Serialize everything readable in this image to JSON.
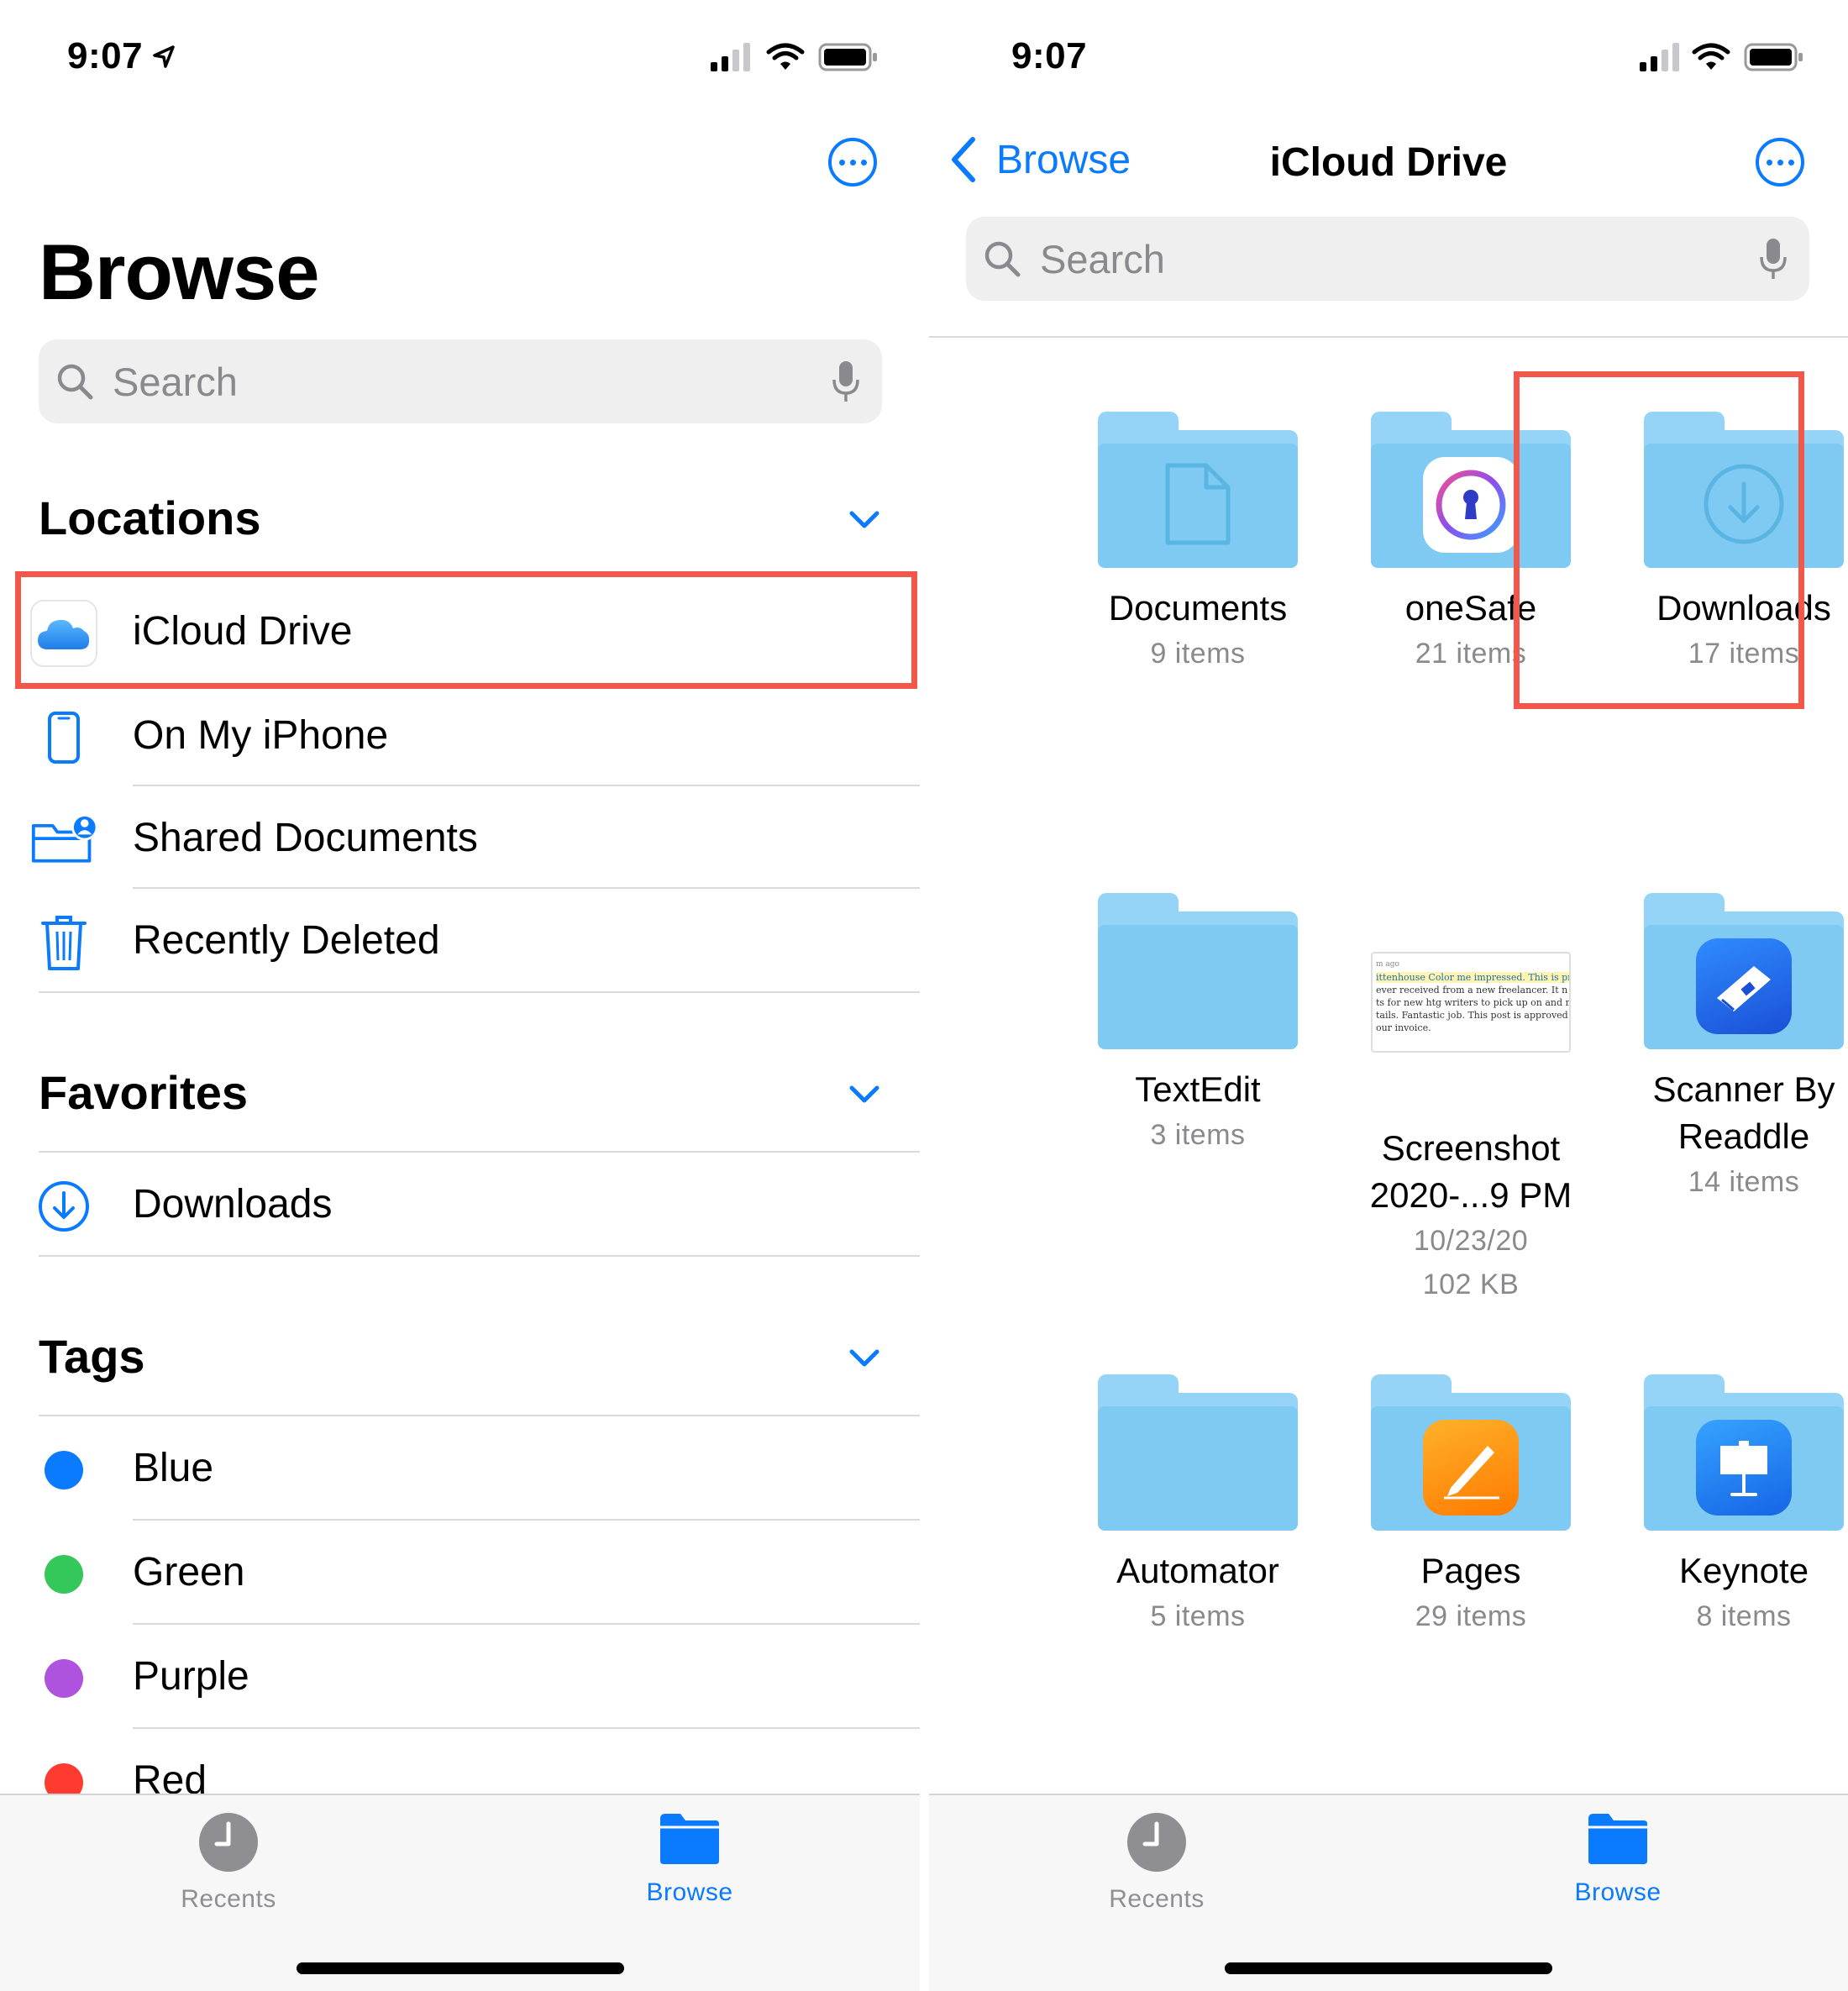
{
  "left": {
    "status": {
      "time": "9:07"
    },
    "title": "Browse",
    "search": {
      "placeholder": "Search"
    },
    "locations": {
      "header": "Locations",
      "items": [
        {
          "label": "iCloud Drive",
          "icon": "icloud-icon"
        },
        {
          "label": "On My iPhone",
          "icon": "iphone-icon"
        },
        {
          "label": "Shared Documents",
          "icon": "shared-folder-icon"
        },
        {
          "label": "Recently Deleted",
          "icon": "trash-icon"
        }
      ]
    },
    "favorites": {
      "header": "Favorites",
      "items": [
        {
          "label": "Downloads",
          "icon": "download-circle-icon"
        }
      ]
    },
    "tags": {
      "header": "Tags",
      "items": [
        {
          "label": "Blue",
          "color": "#0a7aff"
        },
        {
          "label": "Green",
          "color": "#34c759"
        },
        {
          "label": "Purple",
          "color": "#af52de"
        },
        {
          "label": "Red",
          "color": "#ff3b30"
        }
      ]
    },
    "tabbar": {
      "recents": "Recents",
      "browse": "Browse"
    }
  },
  "right": {
    "status": {
      "time": "9:07"
    },
    "nav": {
      "back": "Browse",
      "title": "iCloud Drive"
    },
    "search": {
      "placeholder": "Search"
    },
    "items": [
      {
        "name": "Documents",
        "sub": "9 items"
      },
      {
        "name": "oneSafe",
        "sub": "21 items"
      },
      {
        "name": "Downloads",
        "sub": "17 items"
      },
      {
        "name": "TextEdit",
        "sub": "3 items"
      },
      {
        "name": "Screenshot",
        "name2": "2020-...9 PM",
        "sub": "10/23/20",
        "sub2": "102 KB"
      },
      {
        "name": "Scanner By",
        "name2": "Readdle",
        "sub": "14 items"
      },
      {
        "name": "Automator",
        "sub": "5 items"
      },
      {
        "name": "Pages",
        "sub": "29 items"
      },
      {
        "name": "Keynote",
        "sub": "8 items"
      }
    ],
    "thumbnail_text": [
      "m ago",
      "ittenhouse Color me impressed. This is pr",
      " ever received from a new freelancer. It n",
      "ts for new htg writers to pick up on and m",
      "tails. Fantastic job. This post is approved a",
      "our invoice."
    ],
    "tabbar": {
      "recents": "Recents",
      "browse": "Browse"
    }
  },
  "colors": {
    "accent": "#0a7aff",
    "highlight": "#f1574a",
    "folder": "#95d4f7"
  }
}
